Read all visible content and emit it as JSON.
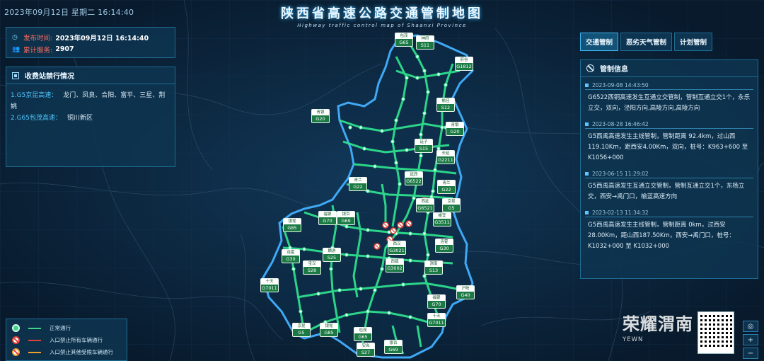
{
  "header": {
    "datetime": "2023年09月12日 星期二 16:14:40",
    "title": "陕西省高速公路交通管制地图",
    "subtitle": "Highway traffic control map of Shaanxi Province"
  },
  "info": {
    "publish_label": "发布时间:",
    "publish_value": "2023年09月12日 16:14:40",
    "served_label": "累计服务:",
    "served_value": "2907"
  },
  "toll": {
    "title": "收费站禁行情况",
    "items": [
      {
        "code": "1.G5京昆高速：",
        "stations": "龙门、凤良、合阳、富平、三星、荆姚"
      },
      {
        "code": "2.G65包茂高速：",
        "stations": "铜川新区"
      }
    ]
  },
  "tabs": [
    "交通管制",
    "恶劣天气管制",
    "计划管制"
  ],
  "control": {
    "title": "管制信息",
    "notices": [
      {
        "date": "2023-09-08 14:43:50",
        "text": "G6522西铜高速发生互通立交管制，管制互通立交1个，永乐立交，双向，泾阳方向,高陵方向,高陵方向"
      },
      {
        "date": "2023-08-28 16:46:42",
        "text": "G5西禹高速发生主线管制，管制距离 92.4km，过山西 119.10Km，距西安4.00Km，双向，桩号：K963+600 至 K1056+000"
      },
      {
        "date": "2023-06-15 11:29:02",
        "text": "G5西禹高速发生互通立交管制，管制互通立交1个，东杨立交，西安→禹门口，榆蓝高速方向"
      },
      {
        "date": "2023-02-13 11:34:32",
        "text": "G5西禹高速发生主线管制，管制距离 0km，过西安 28.00Km，距山西187.50Km，西安→禹门口，桩号：K1032+000 至 K1032+000"
      }
    ]
  },
  "legend": {
    "items": [
      {
        "label": "正常通行",
        "color": "#3fd68c",
        "icon": "normal-icon"
      },
      {
        "label": "入口禁止所有车辆通行",
        "color": "#e0413a",
        "icon": "no-entry-icon"
      },
      {
        "label": "入口禁止其他受限车辆通行",
        "color": "#f0a030",
        "icon": "restricted-entry-icon"
      }
    ]
  },
  "map_buttons": [
    "◎",
    "+",
    "−"
  ],
  "watermark": {
    "title": "荣耀渭南",
    "url": "YEWN"
  },
  "shields": [
    {
      "name": "包茂",
      "code": "G65"
    },
    {
      "name": "神府",
      "code": "S11"
    },
    {
      "name": "府谷",
      "code": "G1812"
    },
    {
      "name": "榆佳",
      "code": "S12"
    },
    {
      "name": "青银",
      "code": "G20"
    },
    {
      "name": "青银",
      "code": "G20"
    },
    {
      "name": "延子",
      "code": "S15"
    },
    {
      "name": "长延",
      "code": "G2211"
    },
    {
      "name": "延西",
      "code": "G6522"
    },
    {
      "name": "青兰",
      "code": "G22"
    },
    {
      "name": "青兰",
      "code": "G22"
    },
    {
      "name": "西延",
      "code": "G6521"
    },
    {
      "name": "京昆",
      "code": "G5"
    },
    {
      "name": "榆宜",
      "code": "G3511"
    },
    {
      "name": "银昆",
      "code": "G85"
    },
    {
      "name": "福银",
      "code": "G70"
    },
    {
      "name": "银百",
      "code": "G69"
    },
    {
      "name": "连霍",
      "code": "G30"
    },
    {
      "name": "西汉",
      "code": "G3021"
    },
    {
      "name": "连霍",
      "code": "G30"
    },
    {
      "name": "宝汉",
      "code": "S28"
    },
    {
      "name": "麟游",
      "code": "S25"
    },
    {
      "name": "西镇",
      "code": "G3002"
    },
    {
      "name": "渭南",
      "code": "S13"
    },
    {
      "name": "十天",
      "code": "G7011"
    },
    {
      "name": "沪陕",
      "code": "G40"
    },
    {
      "name": "福银",
      "code": "G70"
    },
    {
      "name": "十天",
      "code": "G7011"
    },
    {
      "name": "京昆",
      "code": "G5"
    },
    {
      "name": "银昆",
      "code": "G85"
    },
    {
      "name": "包茂",
      "code": "G65"
    },
    {
      "name": "安岚",
      "code": "S27"
    },
    {
      "name": "银百",
      "code": "G69"
    }
  ]
}
